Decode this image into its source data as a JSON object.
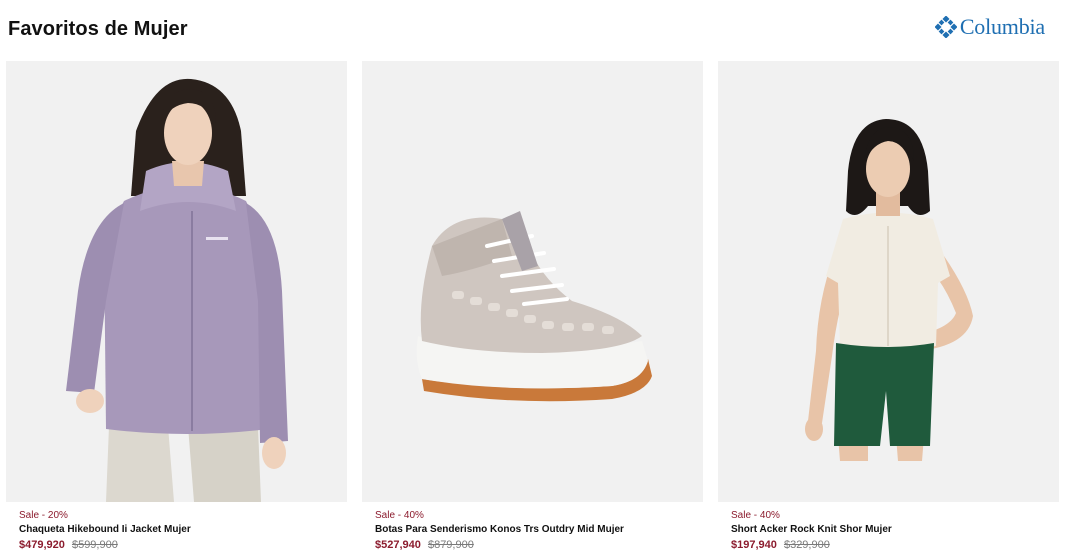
{
  "header": {
    "title": "Favoritos de Mujer",
    "brand_name": "Columbia",
    "brand_icon": "columbia-diamond-logo-icon",
    "brand_color": "#1f6fb2"
  },
  "colors": {
    "sale": "#8c1c2e",
    "original_price": "#7a7a7a",
    "card_background": "#f1f1f1"
  },
  "products": [
    {
      "image": "woman-lavender-rain-jacket",
      "sale_label": "Sale - 20%",
      "name": "Chaqueta Hikebound Ii Jacket Mujer",
      "sale_price": "$479,920",
      "original_price": "$599,900"
    },
    {
      "image": "grey-hiking-mid-boot",
      "sale_label": "Sale - 40%",
      "name": "Botas Para Senderismo Konos Trs Outdry Mid Mujer",
      "sale_price": "$527,940",
      "original_price": "$879,900"
    },
    {
      "image": "woman-cream-knit-shirt-green-shorts",
      "sale_label": "Sale - 40%",
      "name": "Short Acker Rock Knit Shor Mujer",
      "sale_price": "$197,940",
      "original_price": "$329,900"
    }
  ]
}
